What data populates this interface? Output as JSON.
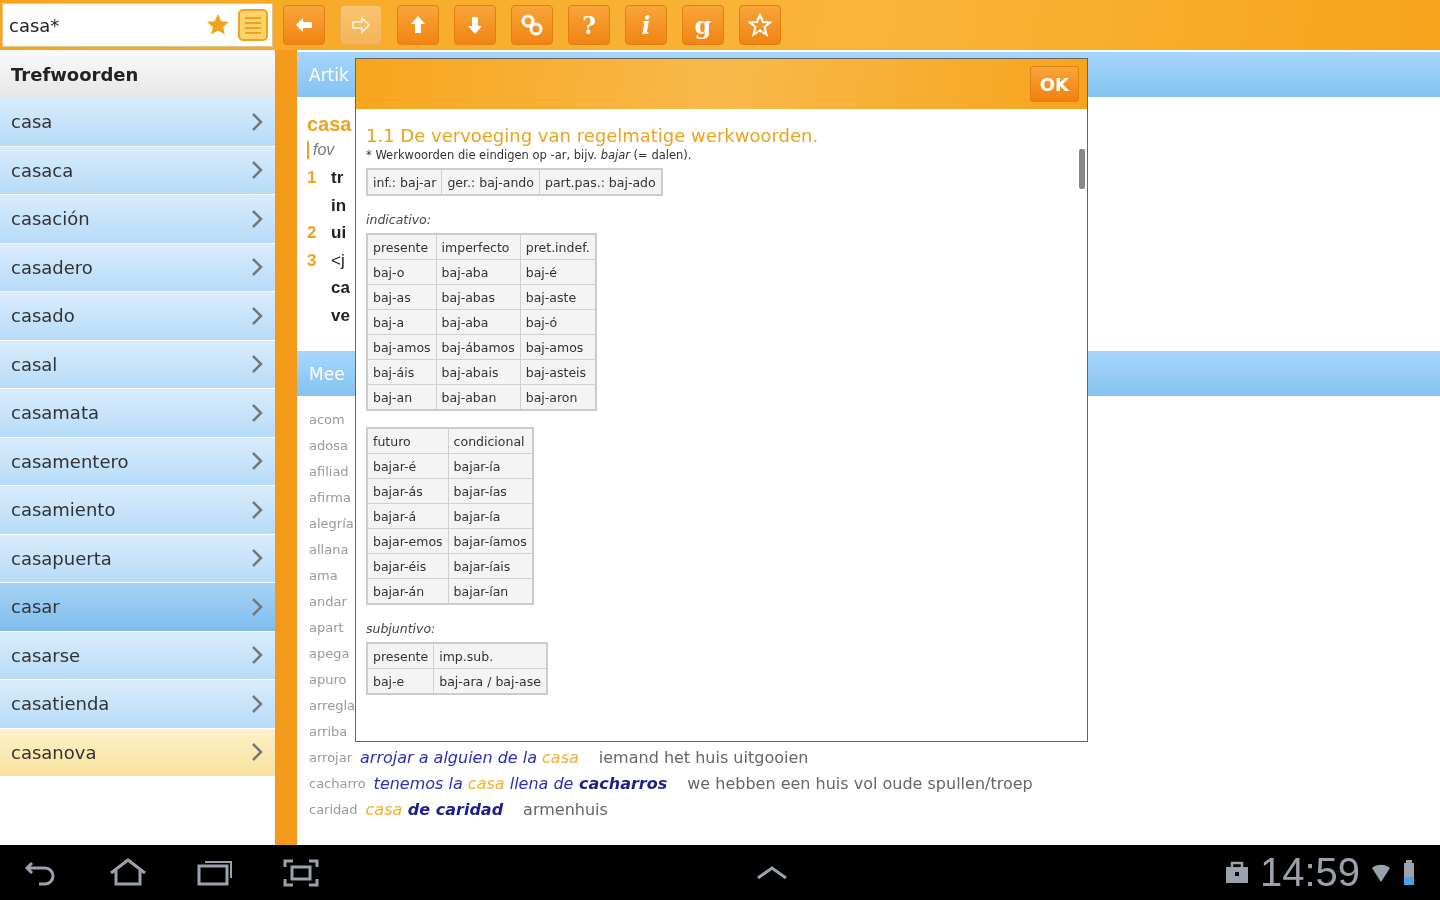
{
  "search": {
    "value": "casa*"
  },
  "search_actions": [
    {
      "kind": "star"
    },
    {
      "kind": "list"
    }
  ],
  "toolbar": [
    {
      "kind": "back",
      "disabled": false
    },
    {
      "kind": "forward",
      "disabled": true
    },
    {
      "kind": "up",
      "disabled": false
    },
    {
      "kind": "down",
      "disabled": false
    },
    {
      "kind": "link",
      "disabled": false
    },
    {
      "kind": "text",
      "label": "?",
      "disabled": false
    },
    {
      "kind": "text",
      "label": "i",
      "disabled": false
    },
    {
      "kind": "text",
      "label": "g",
      "disabled": false
    },
    {
      "kind": "star",
      "disabled": false
    }
  ],
  "sidebar": {
    "title": "Trefwoorden",
    "items": [
      {
        "label": "casa",
        "selected": false,
        "highlighted": false
      },
      {
        "label": "casaca",
        "selected": false,
        "highlighted": false
      },
      {
        "label": "casación",
        "selected": false,
        "highlighted": false
      },
      {
        "label": "casadero",
        "selected": false,
        "highlighted": false
      },
      {
        "label": "casado",
        "selected": false,
        "highlighted": false
      },
      {
        "label": "casal",
        "selected": false,
        "highlighted": false
      },
      {
        "label": "casamata",
        "selected": false,
        "highlighted": false
      },
      {
        "label": "casamentero",
        "selected": false,
        "highlighted": false
      },
      {
        "label": "casamiento",
        "selected": false,
        "highlighted": false
      },
      {
        "label": "casapuerta",
        "selected": false,
        "highlighted": false
      },
      {
        "label": "casar",
        "selected": true,
        "highlighted": false
      },
      {
        "label": "casarse",
        "selected": false,
        "highlighted": false
      },
      {
        "label": "casatienda",
        "selected": false,
        "highlighted": false
      },
      {
        "label": "casanova",
        "selected": false,
        "highlighted": true
      }
    ]
  },
  "article": {
    "tab": "Artik",
    "headword": "casa",
    "grammar": "fov",
    "senses": [
      {
        "number": "1",
        "lines": [
          {
            "text": "tr",
            "bold": true
          },
          {
            "text": "in",
            "bold": true
          }
        ]
      },
      {
        "number": "2",
        "lines": [
          {
            "text": "ui",
            "bold": true
          }
        ]
      },
      {
        "number": "3",
        "lines": [
          {
            "text": "<j",
            "bold": false
          },
          {
            "text": "ca",
            "bold": true
          },
          {
            "text": "ve",
            "bold": true
          }
        ]
      }
    ],
    "section": "Mee",
    "words": [
      {
        "word": "acom"
      },
      {
        "word": "adosa"
      },
      {
        "word": "afiliad"
      },
      {
        "word": "afirma"
      },
      {
        "word": "alegría"
      },
      {
        "word": "allana"
      },
      {
        "word": "ama"
      },
      {
        "word": "andar"
      },
      {
        "word": "apart"
      },
      {
        "word": "apega"
      },
      {
        "word": "apuro"
      },
      {
        "word": "arregla"
      },
      {
        "word": "arriba"
      },
      {
        "word": "arrojar",
        "parts": [
          {
            "text": "arrojar a alguien de la",
            "kind": "plain"
          },
          {
            "text": "casa",
            "kind": "head"
          }
        ],
        "translation": "iemand het huis uitgooien"
      },
      {
        "word": "cacharro",
        "parts": [
          {
            "text": "tenemos la",
            "kind": "plain"
          },
          {
            "text": "casa",
            "kind": "head"
          },
          {
            "text": "llena de",
            "kind": "plain"
          },
          {
            "text": "cacharros",
            "kind": "bold"
          }
        ],
        "translation": "we hebben een huis vol oude spullen/troep"
      },
      {
        "word": "caridad",
        "parts": [
          {
            "text": "casa",
            "kind": "head"
          },
          {
            "text": "de caridad",
            "kind": "bold"
          }
        ],
        "translation": "armenhuis"
      }
    ]
  },
  "dialog": {
    "button": "OK",
    "title": "1.1 De vervoeging van regelmatige werkwoorden.",
    "note": "* Werkwoorden die eindigen op -ar, bijv. *bajar* (= dalen).",
    "blocks": [
      {
        "kind": "table",
        "rows": [
          [
            "inf.: baj-ar",
            "ger.: baj-ando",
            "part.pas.: baj-ado"
          ]
        ]
      },
      {
        "kind": "label",
        "text": "indicativo:"
      },
      {
        "kind": "table",
        "rows": [
          [
            "presente",
            "imperfecto",
            "pret.indef."
          ],
          [
            "baj-o",
            "baj-aba",
            "baj-é"
          ],
          [
            "baj-as",
            "baj-abas",
            "baj-aste"
          ],
          [
            "baj-a",
            "baj-aba",
            "baj-ó"
          ],
          [
            "baj-amos",
            "baj-ábamos",
            "baj-amos"
          ],
          [
            "baj-áis",
            "baj-abais",
            "baj-asteis"
          ],
          [
            "baj-an",
            "baj-aban",
            "baj-aron"
          ]
        ]
      },
      {
        "kind": "table",
        "rows": [
          [
            "futuro",
            "condicional"
          ],
          [
            "bajar-é",
            "bajar-ía"
          ],
          [
            "bajar-ás",
            "bajar-ías"
          ],
          [
            "bajar-á",
            "bajar-ía"
          ],
          [
            "bajar-emos",
            "bajar-íamos"
          ],
          [
            "bajar-éis",
            "bajar-íais"
          ],
          [
            "bajar-án",
            "bajar-ían"
          ]
        ]
      },
      {
        "kind": "label",
        "text": "subjuntivo:"
      },
      {
        "kind": "table",
        "rows": [
          [
            "presente",
            "imp.sub."
          ],
          [
            "baj-e",
            "baj-ara / baj-ase"
          ]
        ]
      }
    ]
  },
  "status_bar": {
    "nav": [
      {
        "kind": "back"
      },
      {
        "kind": "home"
      },
      {
        "kind": "recent"
      },
      {
        "kind": "screenshot"
      }
    ],
    "center": [
      {
        "kind": "up"
      }
    ],
    "tray": [
      {
        "kind": "bag"
      }
    ],
    "time": "14:59",
    "indicators": [
      {
        "kind": "wifi"
      },
      {
        "kind": "battery"
      }
    ]
  }
}
